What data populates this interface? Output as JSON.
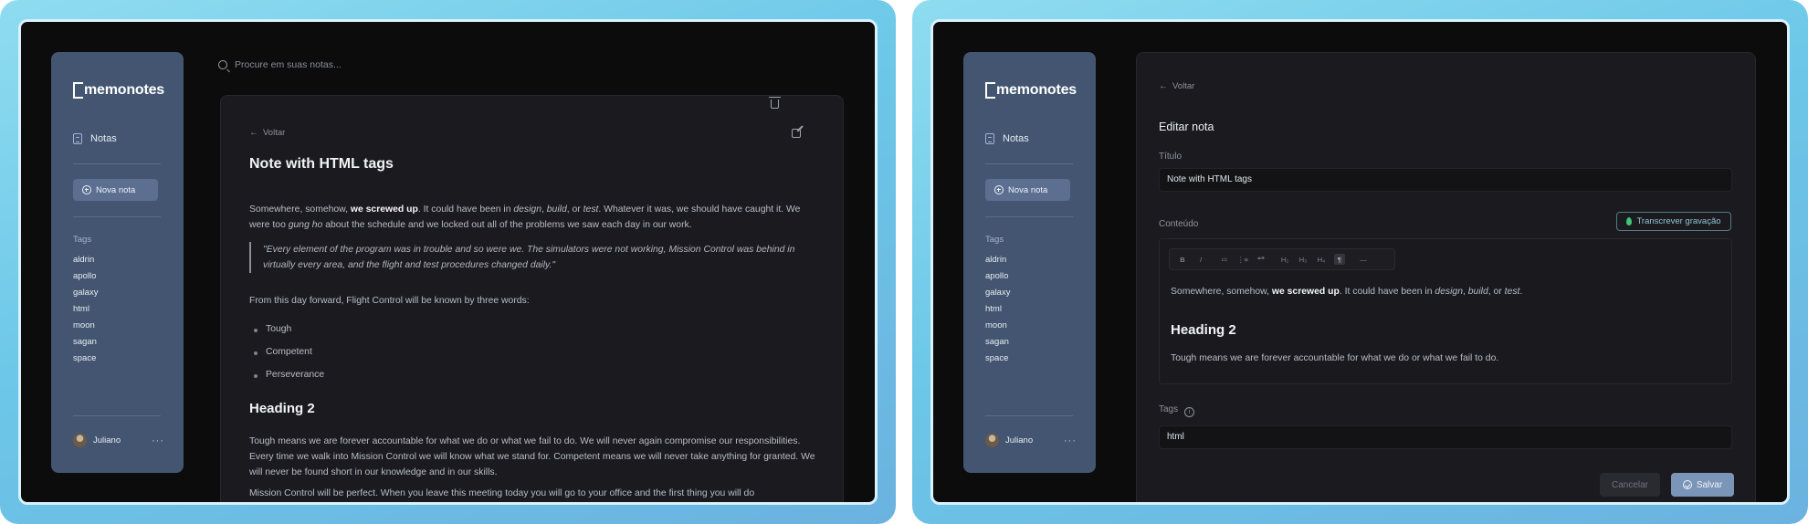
{
  "app": {
    "logo": "memonotes"
  },
  "sidebar": {
    "nav_notes": "Notas",
    "new_note": "Nova nota",
    "tags_label": "Tags",
    "tags": [
      "aldrin",
      "apollo",
      "galaxy",
      "html",
      "moon",
      "sagan",
      "space"
    ],
    "user_name": "Juliano",
    "user_menu": "···"
  },
  "search": {
    "placeholder": "Procure em suas notas..."
  },
  "note": {
    "back": "Voltar",
    "title": "Note with HTML tags",
    "p1_a": "Somewhere, somehow, ",
    "p1_b": "we screwed up",
    "p1_c": ". It could have been in ",
    "p1_d": "design",
    "p1_e": ", ",
    "p1_f": "build",
    "p1_g": ", or ",
    "p1_h": "test",
    "p1_i": ". Whatever it was, we should have caught it. We were too ",
    "p1_j": "gung ho",
    "p1_k": " about the schedule and we locked out all of the problems we saw each day in our work.",
    "quote": "\"Every element of the program was in trouble and so were we. The simulators were not working, Mission Control was behind in virtually every area, and the flight and test procedures changed daily.\"",
    "p2": "From this day forward, Flight Control will be known by three words:",
    "bullets": [
      "Tough",
      "Competent",
      "Perseverance"
    ],
    "heading2": "Heading 2",
    "p3": "Tough means we are forever accountable for what we do or what we fail to do. We will never again compromise our responsibilities. Every time we walk into Mission Control we will know what we stand for. Competent means we will never take anything for granted. We will never be found short in our knowledge and in our skills.",
    "p4": "Mission Control will be perfect. When you leave this meeting today you will go to your office and the first thing you will do"
  },
  "edit": {
    "back": "Voltar",
    "heading": "Editar nota",
    "title_label": "Título",
    "title_value": "Note with HTML tags",
    "content_label": "Conteúdo",
    "transcribe": "Transcrever gravação",
    "toolbar": [
      "B",
      "I",
      "≔",
      "⋮≡",
      "❝❞",
      "H₂",
      "H₃",
      "H₄",
      "¶",
      "—"
    ],
    "content_p1_a": "Somewhere, somehow, ",
    "content_p1_b": "we screwed up",
    "content_p1_c": ". It could have been in ",
    "content_p1_d": "design",
    "content_p1_e": ", ",
    "content_p1_f": "build",
    "content_p1_g": ", or ",
    "content_p1_h": "test",
    "content_p1_i": ".",
    "content_heading": "Heading 2",
    "content_p2": "Tough means we are forever accountable for what we do or what we fail to do.",
    "tags_label": "Tags",
    "tags_value": "html",
    "cancel": "Cancelar",
    "save": "Salvar"
  }
}
